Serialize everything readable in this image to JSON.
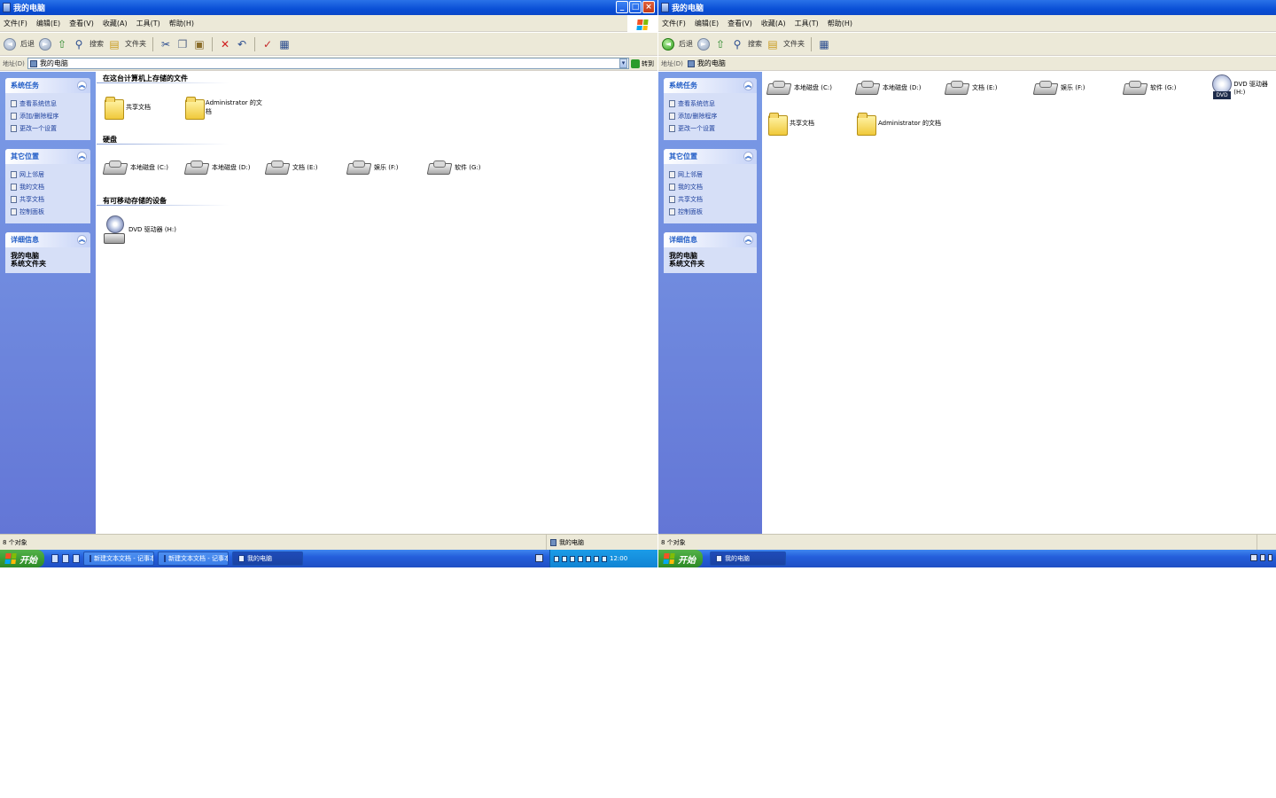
{
  "left": {
    "title": "我的电脑",
    "menu": [
      "文件(F)",
      "编辑(E)",
      "查看(V)",
      "收藏(A)",
      "工具(T)",
      "帮助(H)"
    ],
    "toolbar": {
      "back": "后退",
      "search": "搜索",
      "folders": "文件夹"
    },
    "address": {
      "label": "地址(D)",
      "value": "我的电脑",
      "go": "转到"
    },
    "tasks": {
      "system": {
        "title": "系统任务",
        "items": [
          "查看系统信息",
          "添加/删除程序",
          "更改一个设置"
        ]
      },
      "other": {
        "title": "其它位置",
        "items": [
          "网上邻居",
          "我的文档",
          "共享文档",
          "控制面板"
        ]
      },
      "details": {
        "title": "详细信息",
        "name": "我的电脑",
        "type": "系统文件夹"
      }
    },
    "content": {
      "stored_header": "在这台计算机上存储的文件",
      "stored": [
        "共享文档",
        "Administrator 的文档"
      ],
      "drives_header": "硬盘",
      "drives": [
        "本地磁盘 (C:)",
        "本地磁盘 (D:)",
        "文档 (E:)",
        "娱乐 (F:)",
        "软件 (G:)"
      ],
      "removable_header": "有可移动存储的设备",
      "removable": [
        "DVD 驱动器 (H:)"
      ]
    },
    "status": {
      "left": "8 个对象",
      "right": "我的电脑"
    },
    "taskbar": {
      "start": "开始",
      "buttons": [
        "新建文本文档 - 记事本",
        "新建文本文档 - 记事本",
        "我的电脑"
      ],
      "clock": "12:00"
    }
  },
  "right": {
    "title": "我的电脑",
    "menu": [
      "文件(F)",
      "编辑(E)",
      "查看(V)",
      "收藏(A)",
      "工具(T)",
      "帮助(H)"
    ],
    "toolbar": {
      "back": "后退",
      "search": "搜索",
      "folders": "文件夹"
    },
    "address": {
      "label": "地址(D)",
      "value": "我的电脑"
    },
    "tasks": {
      "system": {
        "title": "系统任务",
        "items": [
          "查看系统信息",
          "添加/删除程序",
          "更改一个设置"
        ]
      },
      "other": {
        "title": "其它位置",
        "items": [
          "网上邻居",
          "我的文档",
          "共享文档",
          "控制面板"
        ]
      },
      "details": {
        "title": "详细信息",
        "name": "我的电脑",
        "type": "系统文件夹"
      }
    },
    "content": {
      "drives": [
        "本地磁盘 (C:)",
        "本地磁盘 (D:)",
        "文档 (E:)",
        "娱乐 (F:)",
        "软件 (G:)"
      ],
      "cd": "DVD 驱动器 (H:)",
      "folders": [
        "共享文档",
        "Administrator 的文档"
      ]
    },
    "status": {
      "left": "8 个对象"
    },
    "taskbar": {
      "start": "开始",
      "buttons": [
        "我的电脑"
      ]
    }
  }
}
